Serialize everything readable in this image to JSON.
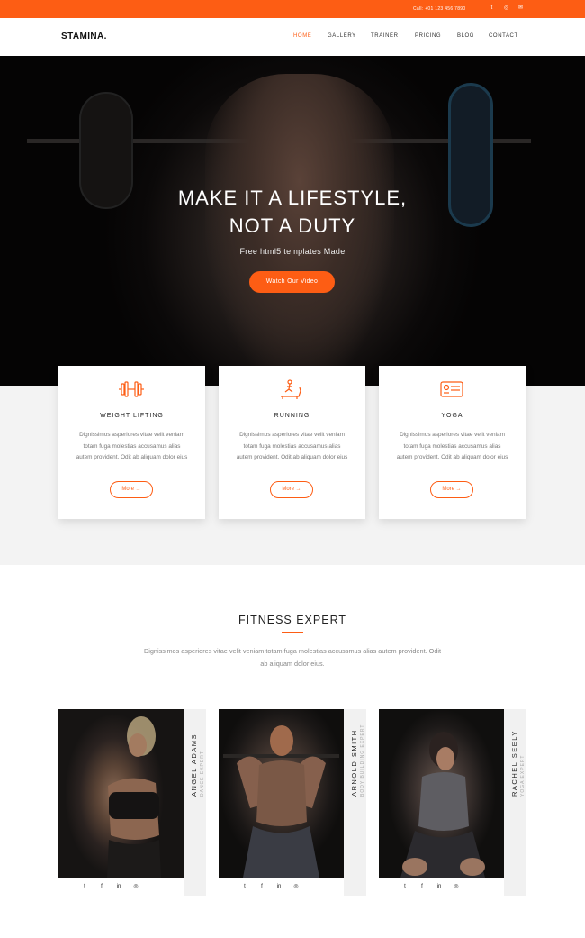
{
  "topbar": {
    "call_text": "Call: +01 123 456 7890",
    "social_icons": [
      "twitter-icon",
      "instagram-icon",
      "email-icon"
    ],
    "social_glyphs": [
      "t",
      "◎",
      "✉"
    ],
    "bg_color": "#fd5d14"
  },
  "nav": {
    "logo": "STAMINA.",
    "items": [
      "HOME",
      "GALLERY",
      "TRAINER",
      "PRICING",
      "BLOG",
      "CONTACT"
    ],
    "active_index": 0
  },
  "hero": {
    "title_line1": "MAKE IT A LIFESTYLE,",
    "title_line2": "NOT A DUTY",
    "subtitle": "Free html5 templates Made",
    "button_label": "Watch Our Video"
  },
  "services": [
    {
      "icon": "dumbbell-icon",
      "title": "WEIGHT LIFTING",
      "description": "Dignissimos asperiores vitae velit veniam totam fuga molestias accusamus alias autem provident. Odit ab aliquam dolor eius",
      "more_label": "More"
    },
    {
      "icon": "treadmill-icon",
      "title": "RUNNING",
      "description": "Dignissimos asperiores vitae velit veniam totam fuga molestias accusamus alias autem provident. Odit ab aliquam dolor eius",
      "more_label": "More"
    },
    {
      "icon": "yoga-mat-icon",
      "title": "YOGA",
      "description": "Dignissimos asperiores vitae velit veniam totam fuga molestias accusamus alias autem provident. Odit ab aliquam dolor eius",
      "more_label": "More"
    }
  ],
  "experts": {
    "title": "FITNESS EXPERT",
    "description": "Dignissimos asperiores vitae velit veniam totam fuga molestias accussmus alias autem provident. Odit ab aliquam dolor eius.",
    "trainers": [
      {
        "name": "ANGEL ADAMS",
        "role": "DANCE EXPERT"
      },
      {
        "name": "ARNOLD SMITH",
        "role": "BODY BUILDING EXPERT"
      },
      {
        "name": "RACHEL SEELY",
        "role": "YOGA EXPERT"
      }
    ],
    "social_icons": [
      "twitter-icon",
      "facebook-icon",
      "linkedin-icon",
      "dribbble-icon"
    ],
    "social_glyphs": [
      "t",
      "f",
      "in",
      "◎"
    ]
  },
  "colors": {
    "accent": "#fd5d14",
    "section_gray": "#f3f3f3"
  }
}
